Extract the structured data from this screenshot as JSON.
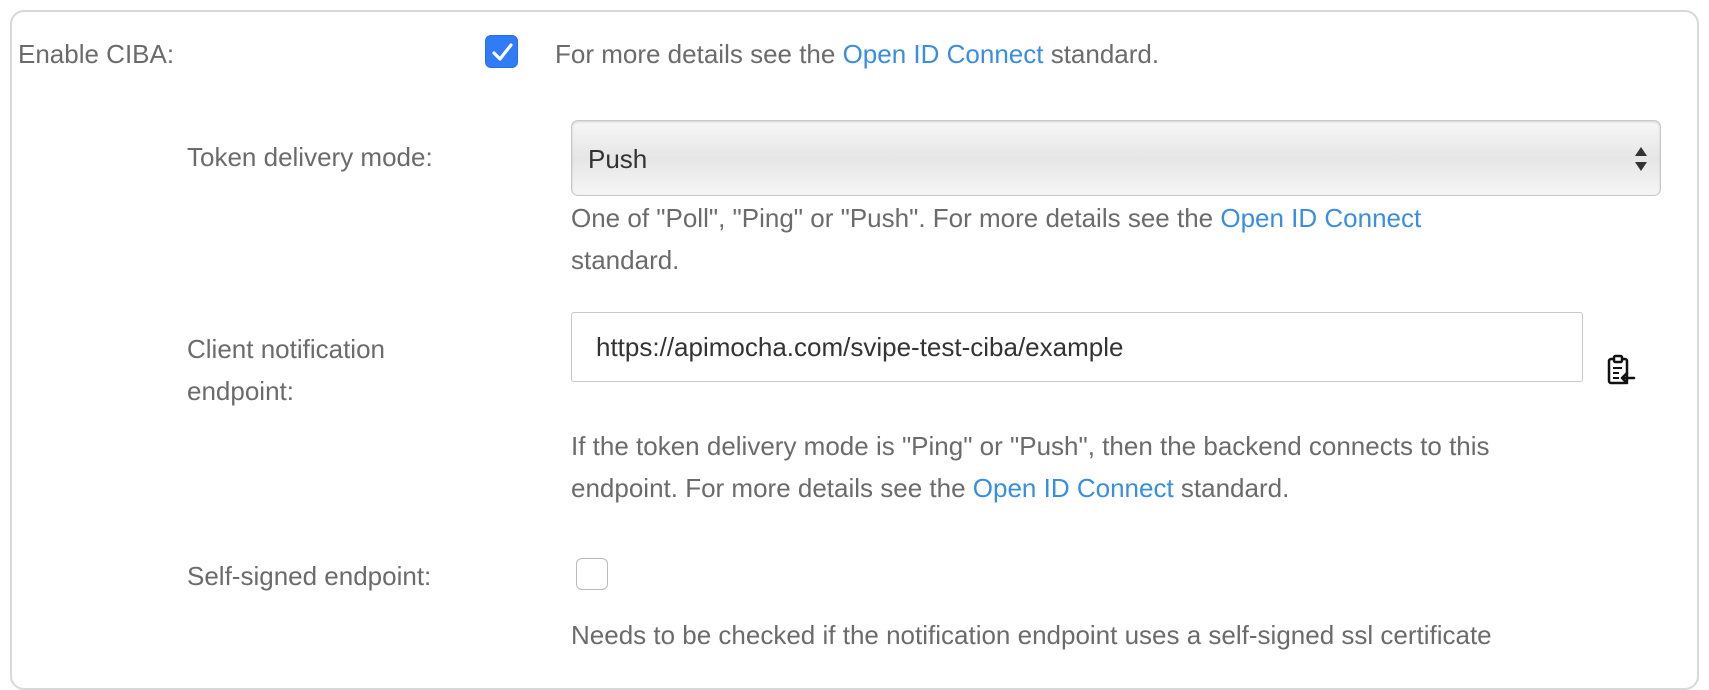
{
  "ciba": {
    "label": "Enable CIBA:",
    "enabled": true,
    "help_prefix": "For more details see the ",
    "help_link": "Open ID Connect",
    "help_suffix": " standard."
  },
  "token_delivery": {
    "label": "Token delivery mode:",
    "value": "Push",
    "help_line1_prefix": "One of \"Poll\", \"Ping\" or \"Push\". For more details see the ",
    "help_link": "Open ID Connect",
    "help_line2": "standard."
  },
  "client_notification": {
    "label_line1": "Client notification",
    "label_line2": "endpoint:",
    "value": "https://apimocha.com/svipe-test-ciba/example",
    "paste_icon": "clipboard-paste-icon",
    "help_line1": "If the token delivery mode is \"Ping\" or \"Push\", then the backend connects to this",
    "help_line2_prefix": "endpoint. For more details see the ",
    "help_link": "Open ID Connect",
    "help_line2_suffix": " standard."
  },
  "self_signed": {
    "label": "Self-signed endpoint:",
    "checked": false,
    "help": "Needs to be checked if the notification endpoint uses a self-signed ssl certificate"
  },
  "colors": {
    "accent": "#2f7cf6",
    "link": "#3a8ee0",
    "text": "#6b6b6b"
  }
}
